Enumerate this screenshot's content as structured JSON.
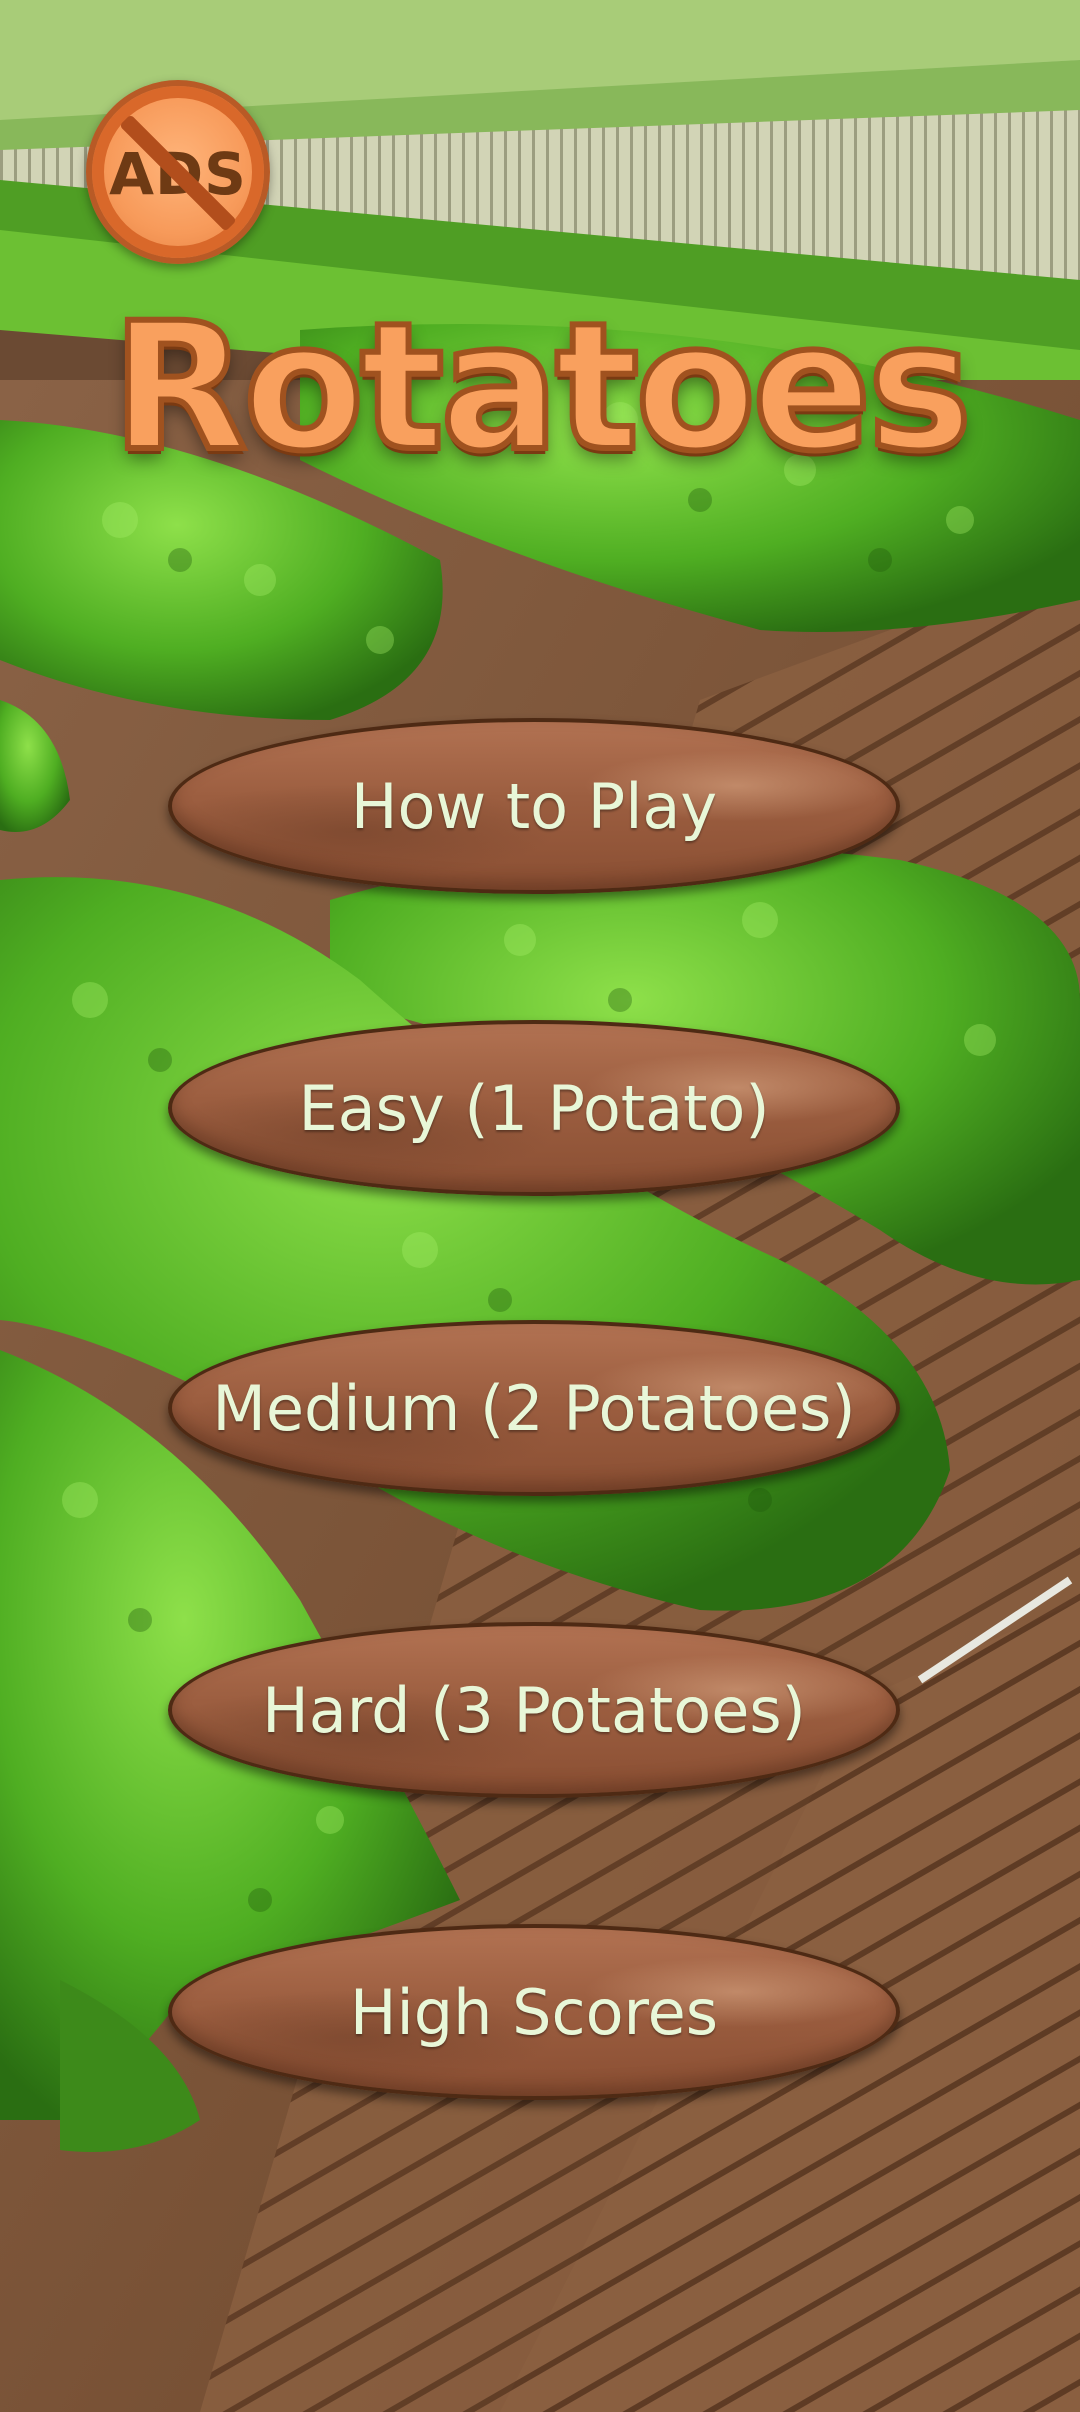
{
  "app": {
    "title": "Rotatoes",
    "no_ads_badge_text": "ADS",
    "no_ads_icon": "no-ads-icon"
  },
  "menu": {
    "how_to_play": "How to Play",
    "easy": "Easy (1 Potato)",
    "medium": "Medium (2 Potatoes)",
    "hard": "Hard (3 Potatoes)",
    "high_scores": "High Scores"
  },
  "colors": {
    "title_fill": "#f9a05e",
    "title_outline": "#a0521f",
    "button_fill": "#9c5e40",
    "button_text": "#e8f7d8",
    "soil": "#7a5236",
    "foliage": "#4caf2a"
  }
}
